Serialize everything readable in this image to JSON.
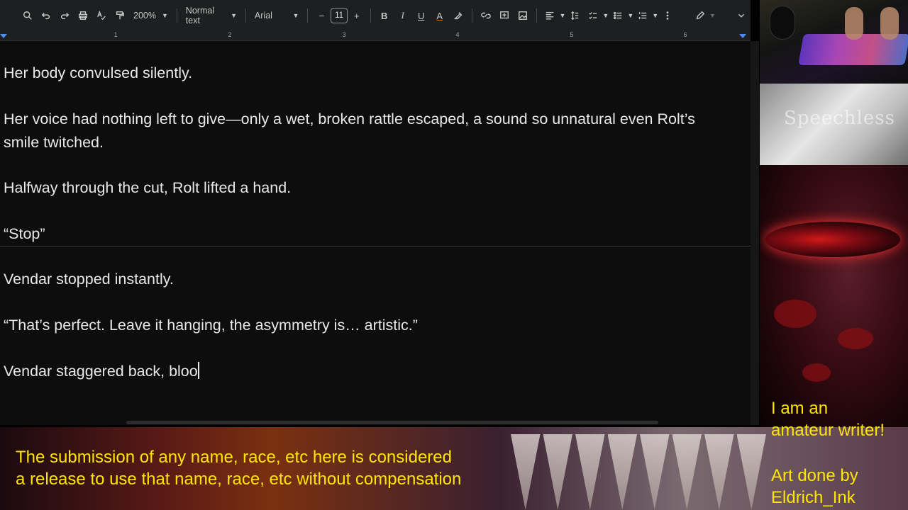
{
  "toolbar": {
    "zoom": "200%",
    "style": "Normal text",
    "font": "Arial",
    "font_size": "11",
    "minus": "−",
    "plus": "+",
    "bold": "B",
    "italic": "I",
    "underline": "U",
    "text_color": "A"
  },
  "ruler": {
    "ticks": [
      "1",
      "2",
      "3",
      "4",
      "5",
      "6"
    ]
  },
  "document": {
    "paragraphs": [
      "Her body convulsed silently.",
      "Her voice had nothing left to give—only a wet, broken rattle escaped, a sound so unnatural even Rolt’s smile twitched.",
      "Halfway through the cut, Rolt lifted a hand.",
      "“Stop”",
      "Vendar stopped instantly.",
      "“That’s perfect. Leave it hanging, the asymmetry is… artistic.”",
      "Vendar staggered back, bloo"
    ]
  },
  "overlay": {
    "piano_title": "Speechless",
    "notice_line1": "The submission of any name, race, etc here is considered",
    "notice_line2": "a release to use that name, race, etc without compensation",
    "writer_line1": "I am an",
    "writer_line2": "amateur writer!",
    "art_line1": "Art done by",
    "art_line2": "Eldrich_Ink"
  },
  "colors": {
    "accent": "#ffe600",
    "ruler_marker": "#4c8df6",
    "doc_background": "#0d0d0d"
  }
}
